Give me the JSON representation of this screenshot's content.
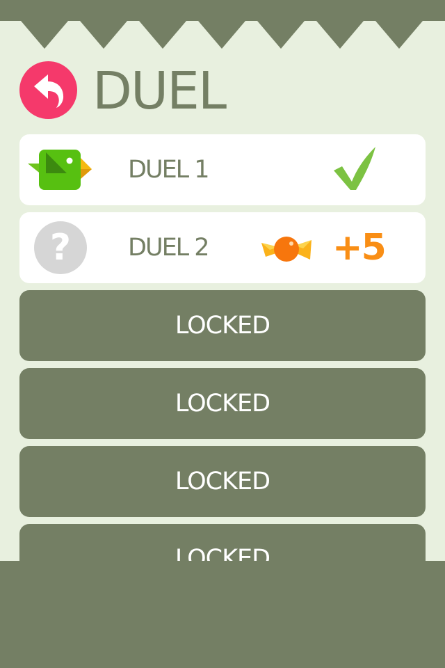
{
  "header": {
    "title": "DUEL",
    "back_icon": "back-arrow-icon"
  },
  "duels": [
    {
      "label": "DUEL 1",
      "icon": "green-bird-icon",
      "status": "completed",
      "status_icon": "checkmark-icon"
    },
    {
      "label": "DUEL 2",
      "icon": "question-mark-icon",
      "icon_text": "?",
      "reward_icon": "candy-icon",
      "reward_text": "+5"
    }
  ],
  "locked_rows": [
    {
      "label": "LOCKED"
    },
    {
      "label": "LOCKED"
    },
    {
      "label": "LOCKED"
    },
    {
      "label": "LOCKED"
    }
  ],
  "colors": {
    "background": "#e8f0df",
    "olive": "#747f64",
    "accent_pink": "#f5396b",
    "check_green": "#7cc242",
    "reward_orange": "#f98e15",
    "card": "#ffffff"
  }
}
